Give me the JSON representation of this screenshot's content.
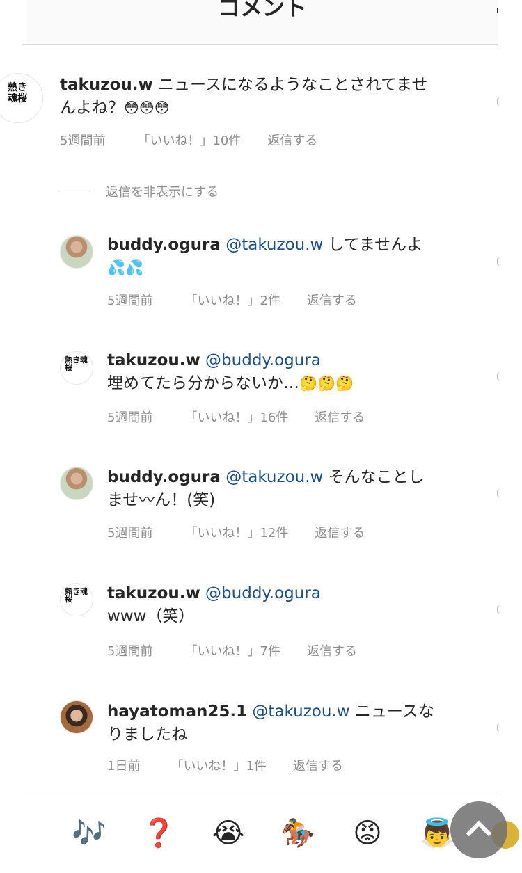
{
  "header": {
    "title": "コメント"
  },
  "comments": [
    {
      "username": "takuzou.w",
      "mention": "",
      "text_line1": "ニュースになるようなことされてませ",
      "text_line2": "んよね？",
      "emojis": "😳😳😳",
      "time": "5週間前",
      "likes": "「いいね！」10件",
      "reply": "返信する"
    },
    {
      "username": "buddy.ogura",
      "mention": "@takuzou.w",
      "text_line1": "してませんよ",
      "emojis": "💦💦",
      "time": "5週間前",
      "likes": "「いいね！」2件",
      "reply": "返信する"
    },
    {
      "username": "takuzou.w",
      "mention": "@buddy.ogura",
      "text_line2": "埋めてたら分からないか…",
      "emojis": "🤔🤔🤔",
      "time": "5週間前",
      "likes": "「いいね！」16件",
      "reply": "返信する"
    },
    {
      "username": "buddy.ogura",
      "mention": "@takuzou.w",
      "text_line1": "そんなことし",
      "text_line2": "ませ〰ん！(笑)",
      "time": "5週間前",
      "likes": "「いいね！」12件",
      "reply": "返信する"
    },
    {
      "username": "takuzou.w",
      "mention": "@buddy.ogura",
      "text_line2": "www（笑）",
      "time": "5週間前",
      "likes": "「いいね！」7件",
      "reply": "返信する"
    },
    {
      "username": "hayatoman25.1",
      "mention": "@takuzou.w",
      "text_line1": "ニュースな",
      "text_line2": "りましたね",
      "time": "1日前",
      "likes": "「いいね！」1件",
      "reply": "返信する"
    }
  ],
  "replies_toggle": "返信を非表示にする",
  "avatar_text": "熱き魂桜",
  "quick_emojis": [
    "🎶",
    "❓",
    "😭",
    "🏇",
    "😡",
    "👼"
  ],
  "colors": {
    "mention": "#1a4f85",
    "meta": "#8e8e8e",
    "text": "#262626"
  }
}
